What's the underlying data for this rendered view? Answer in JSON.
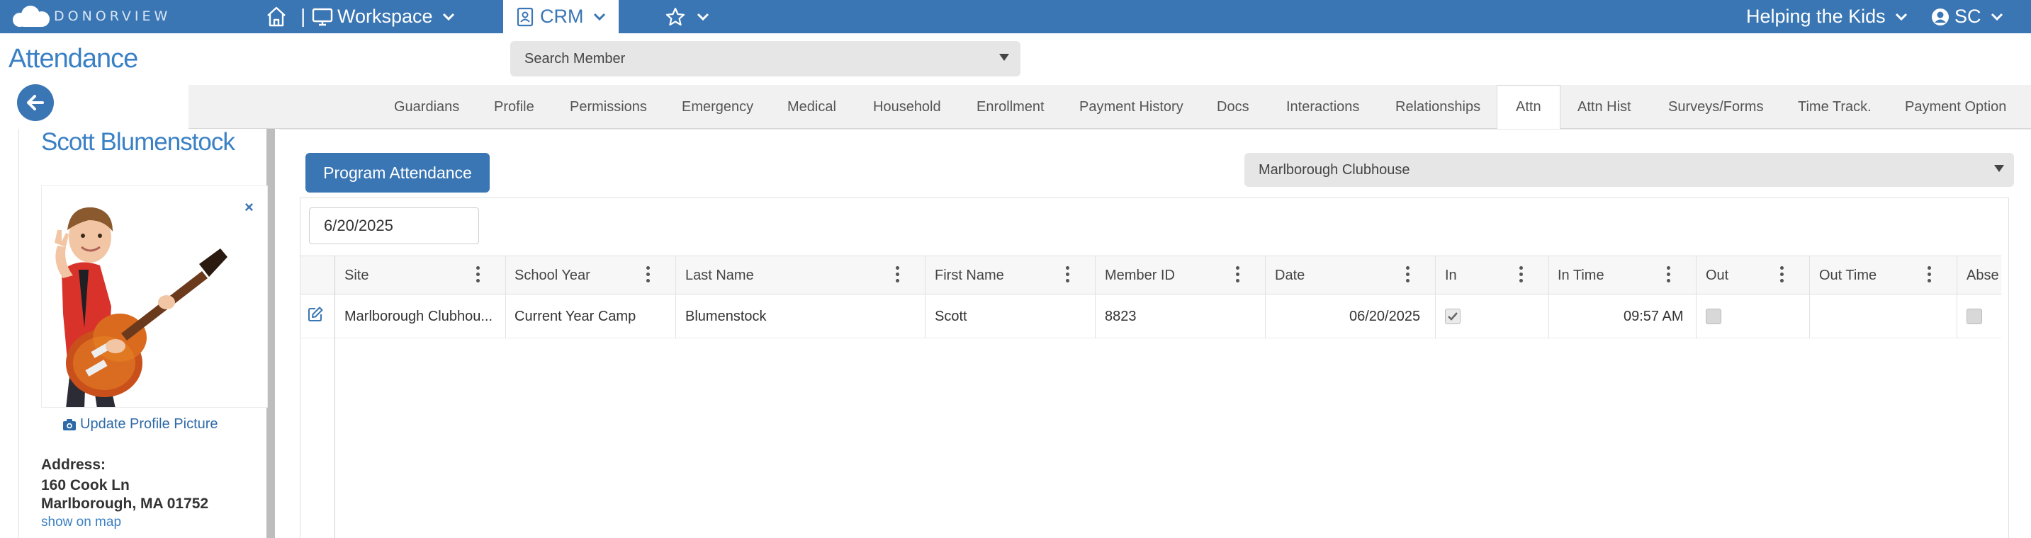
{
  "topbar": {
    "logo_text": "DONORVIEW",
    "workspace_label": "Workspace",
    "crm_label": "CRM",
    "org_label": "Helping the Kids",
    "user_initials": "SC",
    "divider": "|"
  },
  "page": {
    "title": "Attendance",
    "search_placeholder": "Search Member"
  },
  "tabs": [
    {
      "label": "Guardians"
    },
    {
      "label": "Profile"
    },
    {
      "label": "Permissions"
    },
    {
      "label": "Emergency"
    },
    {
      "label": "Medical"
    },
    {
      "label": "Household"
    },
    {
      "label": "Enrollment"
    },
    {
      "label": "Payment History"
    },
    {
      "label": "Docs"
    },
    {
      "label": "Interactions"
    },
    {
      "label": "Relationships"
    },
    {
      "label": "Attn",
      "active": true
    },
    {
      "label": "Attn Hist"
    },
    {
      "label": "Surveys/Forms"
    },
    {
      "label": "Time Track."
    },
    {
      "label": "Payment Option"
    }
  ],
  "member": {
    "name": "Scott Blumenstock",
    "close_symbol": "×",
    "update_picture_label": "Update Profile Picture",
    "address_label": "Address:",
    "address_line1": "160 Cook Ln",
    "address_line2": "Marlborough, MA 01752",
    "map_link": "show on map"
  },
  "main": {
    "program_attendance_button": "Program Attendance",
    "site_select_value": "Marlborough Clubhouse",
    "date_value": "6/20/2025"
  },
  "grid": {
    "columns": [
      "Site",
      "School Year",
      "Last Name",
      "First Name",
      "Member ID",
      "Date",
      "In",
      "In Time",
      "Out",
      "Out Time",
      "Abse"
    ],
    "rows": [
      {
        "site": "Marlborough Clubhou...",
        "school_year": "Current Year Camp",
        "last_name": "Blumenstock",
        "first_name": "Scott",
        "member_id": "8823",
        "date": "06/20/2025",
        "in_checked": true,
        "in_time": "09:57 AM",
        "out_checked": false,
        "out_time": "",
        "absent_checked": false
      }
    ]
  },
  "colors": {
    "brand": "#3a76b4",
    "title_blue": "#3a80c4",
    "tab_bar": "#f1f1f1"
  },
  "icons": [
    "home-icon",
    "monitor-icon",
    "contact-card-icon",
    "star-icon",
    "user-circle-icon",
    "arrow-left-icon",
    "camera-icon",
    "edit-icon",
    "kebab-icon",
    "chevron-down-icon",
    "close-icon"
  ]
}
